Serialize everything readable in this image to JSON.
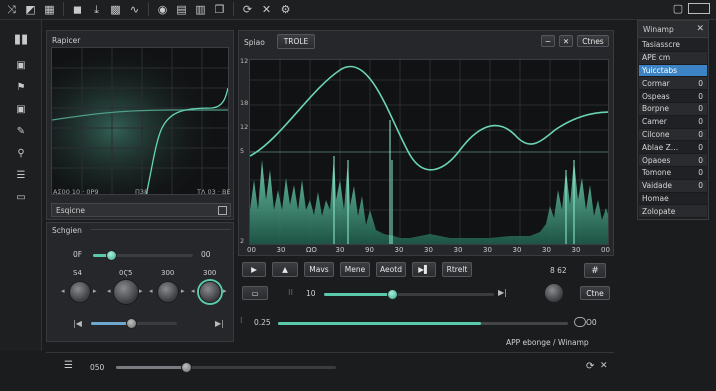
{
  "toolbar": {
    "icons": [
      "shuffle-icon",
      "chart-icon",
      "grid-icon",
      "stop-icon",
      "download-icon",
      "pattern-icon",
      "waveform-icon",
      "record-icon",
      "document-icon",
      "mixer-icon",
      "copy-icon",
      "refresh-icon",
      "close-icon",
      "settings-icon"
    ],
    "glyphs": [
      "⤨",
      "◩",
      "▦",
      "◼",
      "⤓",
      "▩",
      "∿",
      "◉",
      "▤",
      "▥",
      "❐",
      "⟳",
      "✕",
      "⚙"
    ],
    "right_buttons": [
      "▢",
      "▭"
    ]
  },
  "sidebar": {
    "icons": [
      "bars-icon",
      "save-icon",
      "rocket-icon",
      "camera-icon",
      "paint-icon",
      "user-icon",
      "list-icon",
      "monitor-icon"
    ],
    "glyphs": [
      "▮▮",
      "▣",
      "⚑",
      "▣",
      "✎",
      "⚲",
      "☰",
      "▭"
    ]
  },
  "left_panel": {
    "title": "Rapicer",
    "scope_labels": [
      "ΑΣ00 10 · 0Ρ9",
      "Π38",
      "ΤΛ 03 · ΒΕ"
    ],
    "footer_label": "Esqicne",
    "footer_icon": "expand-icon"
  },
  "sliders_panel": {
    "title": "Schgien",
    "main_slider": {
      "left": "0F",
      "right": "00",
      "value": 0.18
    },
    "knob_labels": [
      "S4",
      "0Ϛ5",
      "300",
      "300"
    ],
    "bottom_slider_value": 0.47
  },
  "spectrum": {
    "title": "Spiao",
    "tab": "TROLE",
    "buttons": [
      "−",
      "✕",
      "Ctnes"
    ],
    "y_labels": [
      "12",
      "18",
      "12",
      "5",
      "2"
    ],
    "x_labels": [
      "00",
      "30",
      "ΩO",
      "30",
      "90",
      "30",
      "30",
      "30",
      "30",
      "30",
      "30",
      "30",
      "00"
    ]
  },
  "transport": {
    "buttons": [
      "▶",
      "▲",
      "Mavs",
      "Mene",
      "Aeotd",
      "▶▌",
      "Rtrelt"
    ],
    "count_label": "8 62",
    "count_icon": "grid-icon",
    "ctnes": "Ctne",
    "row2_value": "10",
    "row2_slider": 0.4,
    "row3_value": "0.25",
    "row3_slider": 0.7,
    "row3_right": "O0"
  },
  "list_panel": {
    "title": "Winamp",
    "rows": [
      {
        "label": "Tasiasscre",
        "value": ""
      },
      {
        "label": "APE cm",
        "value": ""
      },
      {
        "label": "Yuicctabs",
        "value": "",
        "selected": true
      },
      {
        "label": "Cormar",
        "value": "0"
      },
      {
        "label": "Ospeas",
        "value": "0"
      },
      {
        "label": "Borpne",
        "value": "0"
      },
      {
        "label": "Camer",
        "value": "0"
      },
      {
        "label": "Cilcone",
        "value": "0"
      },
      {
        "label": "Ablae Z…",
        "value": "0"
      },
      {
        "label": "Opaoes",
        "value": "0"
      },
      {
        "label": "Tomone",
        "value": "0"
      },
      {
        "label": "Vaidade",
        "value": "0"
      },
      {
        "label": "Homae",
        "value": ""
      },
      {
        "label": "Zolopate",
        "value": ""
      }
    ]
  },
  "status": {
    "left_value": "050",
    "slider": 0.32,
    "text": "APP ebonge / Winamp"
  },
  "colors": {
    "accent": "#5bc9ab",
    "select": "#3d84c6"
  }
}
